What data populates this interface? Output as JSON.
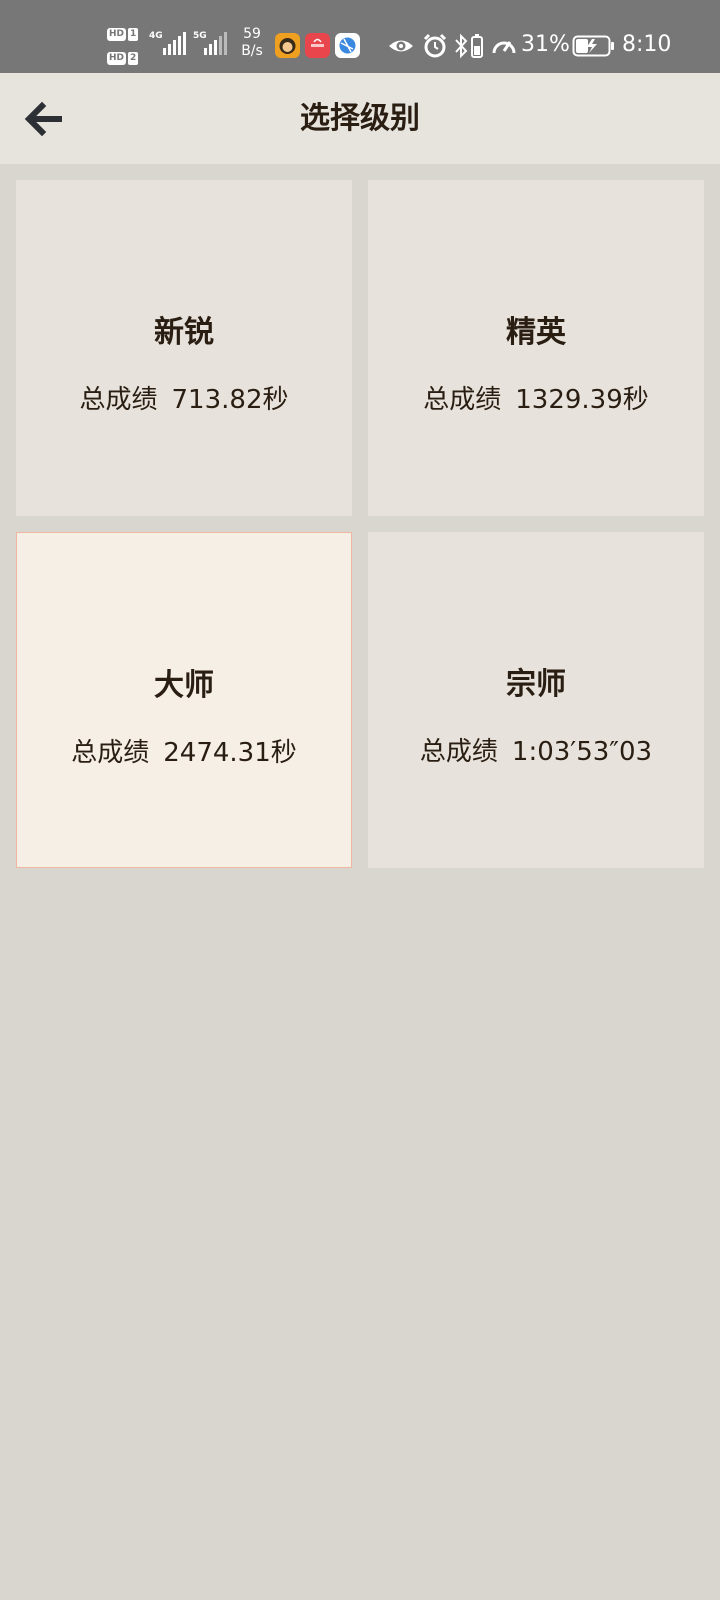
{
  "status_bar": {
    "sim1_hd": "HD",
    "sim1_num": "1",
    "sim2_hd": "HD",
    "sim2_num": "2",
    "net1": "4G",
    "net2": "5G",
    "speed_value": "59",
    "speed_unit": "B/s",
    "battery_percent": "31%",
    "time": "8:10"
  },
  "header": {
    "title": "选择级别"
  },
  "levels": [
    {
      "name": "新锐",
      "score_label": "总成绩",
      "score_value": "713.82秒",
      "selected": false
    },
    {
      "name": "精英",
      "score_label": "总成绩",
      "score_value": "1329.39秒",
      "selected": false
    },
    {
      "name": "大师",
      "score_label": "总成绩",
      "score_value": "2474.31秒",
      "selected": true
    },
    {
      "name": "宗师",
      "score_label": "总成绩",
      "score_value": "1:03′53″03",
      "selected": false
    }
  ],
  "colors": {
    "status_bar_bg": "#777777",
    "app_bar_bg": "#e7e3dd",
    "page_bg": "#d9d6cf",
    "card_bg": "#e7e3dc",
    "selected_card_bg": "#f5efe6",
    "selected_card_border": "#f0b8a4",
    "text": "#2a1e12"
  },
  "icons": {
    "back": "arrow-left-icon",
    "eye": "eye-icon",
    "alarm": "alarm-icon",
    "bluetooth": "bluetooth-icon",
    "battery_small": "battery-small-icon",
    "speedometer": "speedometer-icon",
    "battery": "battery-charging-icon"
  }
}
